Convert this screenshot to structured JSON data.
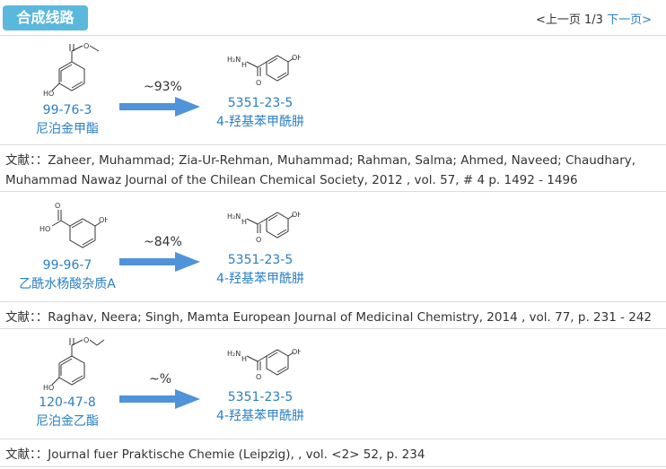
{
  "header": {
    "title": "合成线路",
    "pager": {
      "prev": "<上一页",
      "current": "1/3",
      "next": "下一页>"
    }
  },
  "routes": [
    {
      "reactant": {
        "cas": "99-76-3",
        "name": "尼泊金甲酯"
      },
      "product": {
        "cas": "5351-23-5",
        "name": "4-羟基苯甲酰肼"
      },
      "yield": "~93%",
      "ref_label": "文献：",
      "ref_text": "：Zaheer, Muhammad; Zia-Ur-Rehman, Muhammad; Rahman, Salma; Ahmed, Naveed; Chaudhary, Muhammad Nawaz Journal of the Chilean Chemical Society, 2012 , vol. 57, # 4 p. 1492 - 1496"
    },
    {
      "reactant": {
        "cas": "99-96-7",
        "name": "乙酰水杨酸杂质A"
      },
      "product": {
        "cas": "5351-23-5",
        "name": "4-羟基苯甲酰肼"
      },
      "yield": "~84%",
      "ref_label": "文献：",
      "ref_text": "：Raghav, Neera; Singh, Mamta European Journal of Medicinal Chemistry, 2014 , vol. 77, p. 231 - 242"
    },
    {
      "reactant": {
        "cas": "120-47-8",
        "name": "尼泊金乙酯"
      },
      "product": {
        "cas": "5351-23-5",
        "name": "4-羟基苯甲酰肼"
      },
      "yield": "~%",
      "ref_label": "文献：",
      "ref_text": "：Journal fuer Praktische Chemie (Leipzig), , vol. <2> 52, p. 234"
    }
  ],
  "structure_labels": {
    "ho": "HO",
    "oh": "OH",
    "o": "O",
    "hn": "H",
    "n": "N",
    "h2n": "H₂N"
  },
  "colors": {
    "accent": "#5bb8dd",
    "link": "#2a7fc4",
    "arrow": "#4f93d8"
  }
}
